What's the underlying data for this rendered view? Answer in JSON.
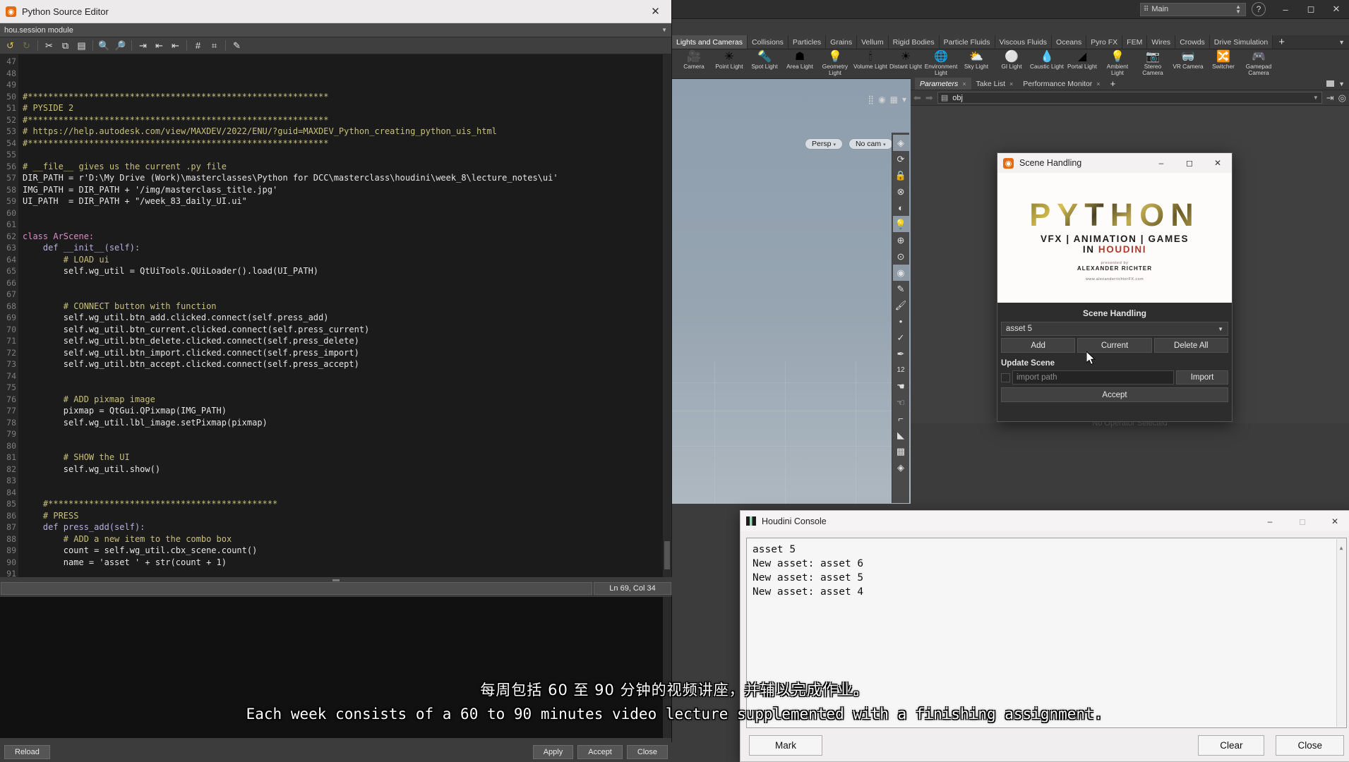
{
  "python_editor": {
    "window_title": "Python Source Editor",
    "logo_icon": "houdini-spiral-icon",
    "close_icon": "close-icon",
    "module_bar": "hou.session module",
    "toolbar_icons": [
      {
        "name": "undo-icon",
        "glyph": "↶"
      },
      {
        "name": "redo-icon",
        "glyph": "↷"
      },
      {
        "name": "cut-icon",
        "glyph": "✂"
      },
      {
        "name": "copy-icon",
        "glyph": "⧉"
      },
      {
        "name": "paste-icon",
        "glyph": "Ὄb"
      },
      {
        "name": "find-icon",
        "glyph": "ὐd"
      },
      {
        "name": "find-replace-icon",
        "glyph": "ὐe"
      },
      {
        "name": "indent-icon",
        "glyph": "⇥"
      },
      {
        "name": "unindent-icon",
        "glyph": "⇤"
      },
      {
        "name": "outdent-icon",
        "glyph": "⇤"
      },
      {
        "name": "comment-icon",
        "glyph": "#"
      },
      {
        "name": "uncomment-icon",
        "glyph": "⌨"
      },
      {
        "name": "edit-external-icon",
        "glyph": "✎"
      }
    ],
    "first_line_number": 47,
    "lines": [
      {
        "n": 47,
        "text": ""
      },
      {
        "n": 48,
        "text": ""
      },
      {
        "n": 49,
        "text": ""
      },
      {
        "n": 50,
        "text": "#***********************************************************",
        "cls": "c-com"
      },
      {
        "n": 51,
        "text": "# PYSIDE 2",
        "cls": "c-com"
      },
      {
        "n": 52,
        "text": "#***********************************************************",
        "cls": "c-com"
      },
      {
        "n": 53,
        "text": "# https://help.autodesk.com/view/MAXDEV/2022/ENU/?guid=MAXDEV_Python_creating_python_uis_html",
        "cls": "c-com"
      },
      {
        "n": 54,
        "text": "#***********************************************************",
        "cls": "c-com"
      },
      {
        "n": 55,
        "text": ""
      },
      {
        "n": 56,
        "text": "# __file__ gives us the current .py file",
        "cls": "c-com"
      },
      {
        "n": 57,
        "text": "DIR_PATH = r'D:\\My Drive (Work)\\masterclasses\\Python for DCC\\masterclass\\houdini\\week_8\\lecture_notes\\ui'"
      },
      {
        "n": 58,
        "text": "IMG_PATH = DIR_PATH + '/img/masterclass_title.jpg'"
      },
      {
        "n": 59,
        "text": "UI_PATH  = DIR_PATH + \"/week_83_daily_UI.ui\""
      },
      {
        "n": 60,
        "text": ""
      },
      {
        "n": 61,
        "text": ""
      },
      {
        "n": 62,
        "text": "class ArScene:",
        "cls": "c-kw"
      },
      {
        "n": 63,
        "text": "    def __init__(self):",
        "cls": "c-def"
      },
      {
        "n": 64,
        "text": "        # LOAD ui",
        "cls": "c-com"
      },
      {
        "n": 65,
        "text": "        self.wg_util = QtUiTools.QUiLoader().load(UI_PATH)"
      },
      {
        "n": 66,
        "text": ""
      },
      {
        "n": 67,
        "text": ""
      },
      {
        "n": 68,
        "text": "        # CONNECT button with function",
        "cls": "c-com"
      },
      {
        "n": 69,
        "text": "        self.wg_util.btn_add.clicked.connect(self.press_add)"
      },
      {
        "n": 70,
        "text": "        self.wg_util.btn_current.clicked.connect(self.press_current)"
      },
      {
        "n": 71,
        "text": "        self.wg_util.btn_delete.clicked.connect(self.press_delete)"
      },
      {
        "n": 72,
        "text": "        self.wg_util.btn_import.clicked.connect(self.press_import)"
      },
      {
        "n": 73,
        "text": "        self.wg_util.btn_accept.clicked.connect(self.press_accept)"
      },
      {
        "n": 74,
        "text": ""
      },
      {
        "n": 75,
        "text": ""
      },
      {
        "n": 76,
        "text": "        # ADD pixmap image",
        "cls": "c-com"
      },
      {
        "n": 77,
        "text": "        pixmap = QtGui.QPixmap(IMG_PATH)"
      },
      {
        "n": 78,
        "text": "        self.wg_util.lbl_image.setPixmap(pixmap)"
      },
      {
        "n": 79,
        "text": ""
      },
      {
        "n": 80,
        "text": ""
      },
      {
        "n": 81,
        "text": "        # SHOW the UI",
        "cls": "c-com"
      },
      {
        "n": 82,
        "text": "        self.wg_util.show()"
      },
      {
        "n": 83,
        "text": ""
      },
      {
        "n": 84,
        "text": ""
      },
      {
        "n": 85,
        "text": "    #*********************************************",
        "cls": "c-com"
      },
      {
        "n": 86,
        "text": "    # PRESS",
        "cls": "c-com"
      },
      {
        "n": 87,
        "text": "    def press_add(self):",
        "cls": "c-def"
      },
      {
        "n": 88,
        "text": "        # ADD a new item to the combo box",
        "cls": "c-com"
      },
      {
        "n": 89,
        "text": "        count = self.wg_util.cbx_scene.count()"
      },
      {
        "n": 90,
        "text": "        name = 'asset ' + str(count + 1)"
      },
      {
        "n": 91,
        "text": ""
      }
    ],
    "status": {
      "message": "",
      "line_col": "Ln 69, Col 34"
    },
    "buttons": {
      "reload": "Reload",
      "apply": "Apply",
      "accept": "Accept",
      "close": "Close"
    }
  },
  "houdini": {
    "desktop_name": "Main",
    "desktop_icon": "desktop-layout-icon",
    "help_icon": "help-icon",
    "window_controls": {
      "minimize": "minimize-icon",
      "maximize": "maximize-icon",
      "close": "close-icon"
    },
    "shelf_tabs": [
      {
        "label": "Lights and Cameras",
        "active": true
      },
      {
        "label": "Collisions",
        "active": false
      },
      {
        "label": "Particles",
        "active": false
      },
      {
        "label": "Grains",
        "active": false
      },
      {
        "label": "Vellum",
        "active": false
      },
      {
        "label": "Rigid Bodies",
        "active": false
      },
      {
        "label": "Particle Fluids",
        "active": false
      },
      {
        "label": "Viscous Fluids",
        "active": false
      },
      {
        "label": "Oceans",
        "active": false
      },
      {
        "label": "Pyro FX",
        "active": false
      },
      {
        "label": "FEM",
        "active": false
      },
      {
        "label": "Wires",
        "active": false
      },
      {
        "label": "Crowds",
        "active": false
      },
      {
        "label": "Drive Simulation",
        "active": false
      }
    ],
    "shelf_add_label": "+",
    "shelf_tools": [
      {
        "label": "Camera",
        "icon": "camera-icon",
        "glyph": "🎥"
      },
      {
        "label": "Point Light",
        "icon": "point-light-icon",
        "glyph": "✳"
      },
      {
        "label": "Spot Light",
        "icon": "spot-light-icon",
        "glyph": "🔦"
      },
      {
        "label": "Area Light",
        "icon": "area-light-icon",
        "glyph": "☗"
      },
      {
        "label": "Geometry\nLight",
        "icon": "geometry-light-icon",
        "glyph": "💡"
      },
      {
        "label": "Volume Light",
        "icon": "volume-light-icon",
        "glyph": "🕯"
      },
      {
        "label": "Distant Light",
        "icon": "distant-light-icon",
        "glyph": "☀"
      },
      {
        "label": "Environment\nLight",
        "icon": "environment-light-icon",
        "glyph": "🌐"
      },
      {
        "label": "Sky Light",
        "icon": "sky-light-icon",
        "glyph": "⛅"
      },
      {
        "label": "GI Light",
        "icon": "gi-light-icon",
        "glyph": "⚪"
      },
      {
        "label": "Caustic Light",
        "icon": "caustic-light-icon",
        "glyph": "💧"
      },
      {
        "label": "Portal Light",
        "icon": "portal-light-icon",
        "glyph": "◢"
      },
      {
        "label": "Ambient Light",
        "icon": "ambient-light-icon",
        "glyph": "💡"
      },
      {
        "label": "Stereo\nCamera",
        "icon": "stereo-camera-icon",
        "glyph": "📷"
      },
      {
        "label": "VR Camera",
        "icon": "vr-camera-icon",
        "glyph": "🥽"
      },
      {
        "label": "Switcher",
        "icon": "switcher-icon",
        "glyph": "🔀"
      },
      {
        "label": "Gamepad\nCamera",
        "icon": "gamepad-camera-icon",
        "glyph": "🎮"
      }
    ],
    "parameter_tabs": [
      {
        "label": "Parameters",
        "active": true,
        "close": "×"
      },
      {
        "label": "Take List",
        "active": false,
        "close": "×"
      },
      {
        "label": "Performance Monitor",
        "active": false,
        "close": "×"
      }
    ],
    "parameter_tab_add": "+",
    "parameter_path": "obj",
    "parameter_empty_text": "No Operator Selected",
    "viewport": {
      "persp_label": "Persp",
      "cam_label": "No cam",
      "toolbar_icons": [
        "select-mode-icon",
        "handle-icon",
        "lock-icon",
        "no-snap-icon",
        "half-circle-icon",
        "light-bulb-icon",
        "light-add-icon",
        "light-place-icon",
        "material-icon",
        "paint-icon",
        "paint-layer-icon",
        "point-icon",
        "edit-icon",
        "pick-icon",
        "number-12-icon",
        "soft-select-icon",
        "soft-12-icon",
        "measure-icon",
        "knife-icon",
        "texture-icon",
        "shade-icon"
      ]
    }
  },
  "scene_dialog": {
    "title": "Scene Handling",
    "logo_icon": "houdini-spiral-icon",
    "window_controls": {
      "minimize": "minimize-icon",
      "maximize": "maximize-icon",
      "close": "close-icon"
    },
    "banner": {
      "title": "PYTHON",
      "subtitle_line1": "VFX | ANIMATION | GAMES",
      "subtitle_line2_prefix": "IN ",
      "subtitle_line2_highlight": "HOUDINI",
      "presented_by": "presented by",
      "author": "ALEXANDER RICHTER",
      "url": "www.alexanderrichterFX.com"
    },
    "heading": "Scene Handling",
    "combo_value": "asset 5",
    "combo_caret": "chevron-down-icon",
    "buttons": {
      "add": "Add",
      "current": "Current",
      "delete_all": "Delete All",
      "import": "Import",
      "accept": "Accept"
    },
    "update_scene_label": "Update Scene",
    "import_path_placeholder": "import path",
    "cursor_icon": "mouse-cursor-icon"
  },
  "console": {
    "title": "Houdini Console",
    "logo_icon": "houdini-console-icon",
    "window_controls": {
      "minimize": "minimize-icon",
      "maximize": "maximize-icon",
      "close": "close-icon"
    },
    "output_lines": [
      "New asset: asset 4",
      "New asset: asset 5",
      "New asset: asset 6",
      "asset 5"
    ],
    "buttons": {
      "mark": "Mark",
      "clear": "Clear",
      "close": "Close"
    },
    "scroll_up_icon": "scroll-up-icon"
  },
  "subtitles": {
    "chinese": "每周包括 60 至 90 分钟的视频讲座，并辅以完成作业。",
    "english": "Each week consists of a 60 to 90 minutes video lecture supplemented with a finishing assignment."
  },
  "colors": {
    "accent_orange": "#e8690b",
    "panel_dark": "#3c3c3c",
    "code_bg": "#1b1b1b",
    "comment_yellow": "#c9c07a",
    "keyword_pink": "#d98cc6"
  }
}
